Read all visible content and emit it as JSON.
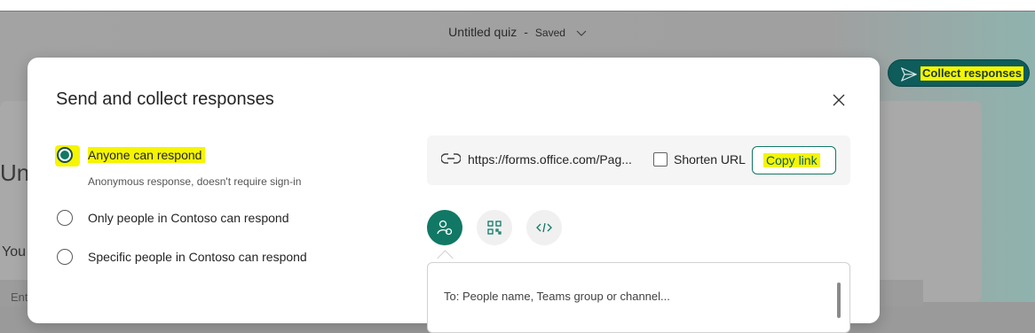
{
  "header": {
    "title": "Untitled quiz",
    "separator": "-",
    "status": "Saved"
  },
  "toolbar": {
    "collect_label": "Collect responses"
  },
  "background": {
    "heading_fragment": "Unt",
    "text_fragment": "You",
    "input_fragment": "Ent"
  },
  "dialog": {
    "title": "Send and collect responses",
    "options": [
      {
        "label": "Anyone can respond",
        "sub": "Anonymous response, doesn't require sign-in",
        "checked": true
      },
      {
        "label": "Only people in Contoso can respond",
        "checked": false
      },
      {
        "label": "Specific people in Contoso can respond",
        "checked": false
      }
    ],
    "link": {
      "url": "https://forms.office.com/Pag...",
      "shorten_label": "Shorten URL",
      "shorten_checked": false,
      "copy_label": "Copy link"
    },
    "share_icons": [
      "invite-people-icon",
      "qr-code-icon",
      "embed-code-icon"
    ],
    "to_placeholder": "To: People name, Teams group or channel..."
  },
  "colors": {
    "accent": "#117865",
    "highlight": "#f5f500",
    "collect_bg": "#0e5c5b"
  }
}
